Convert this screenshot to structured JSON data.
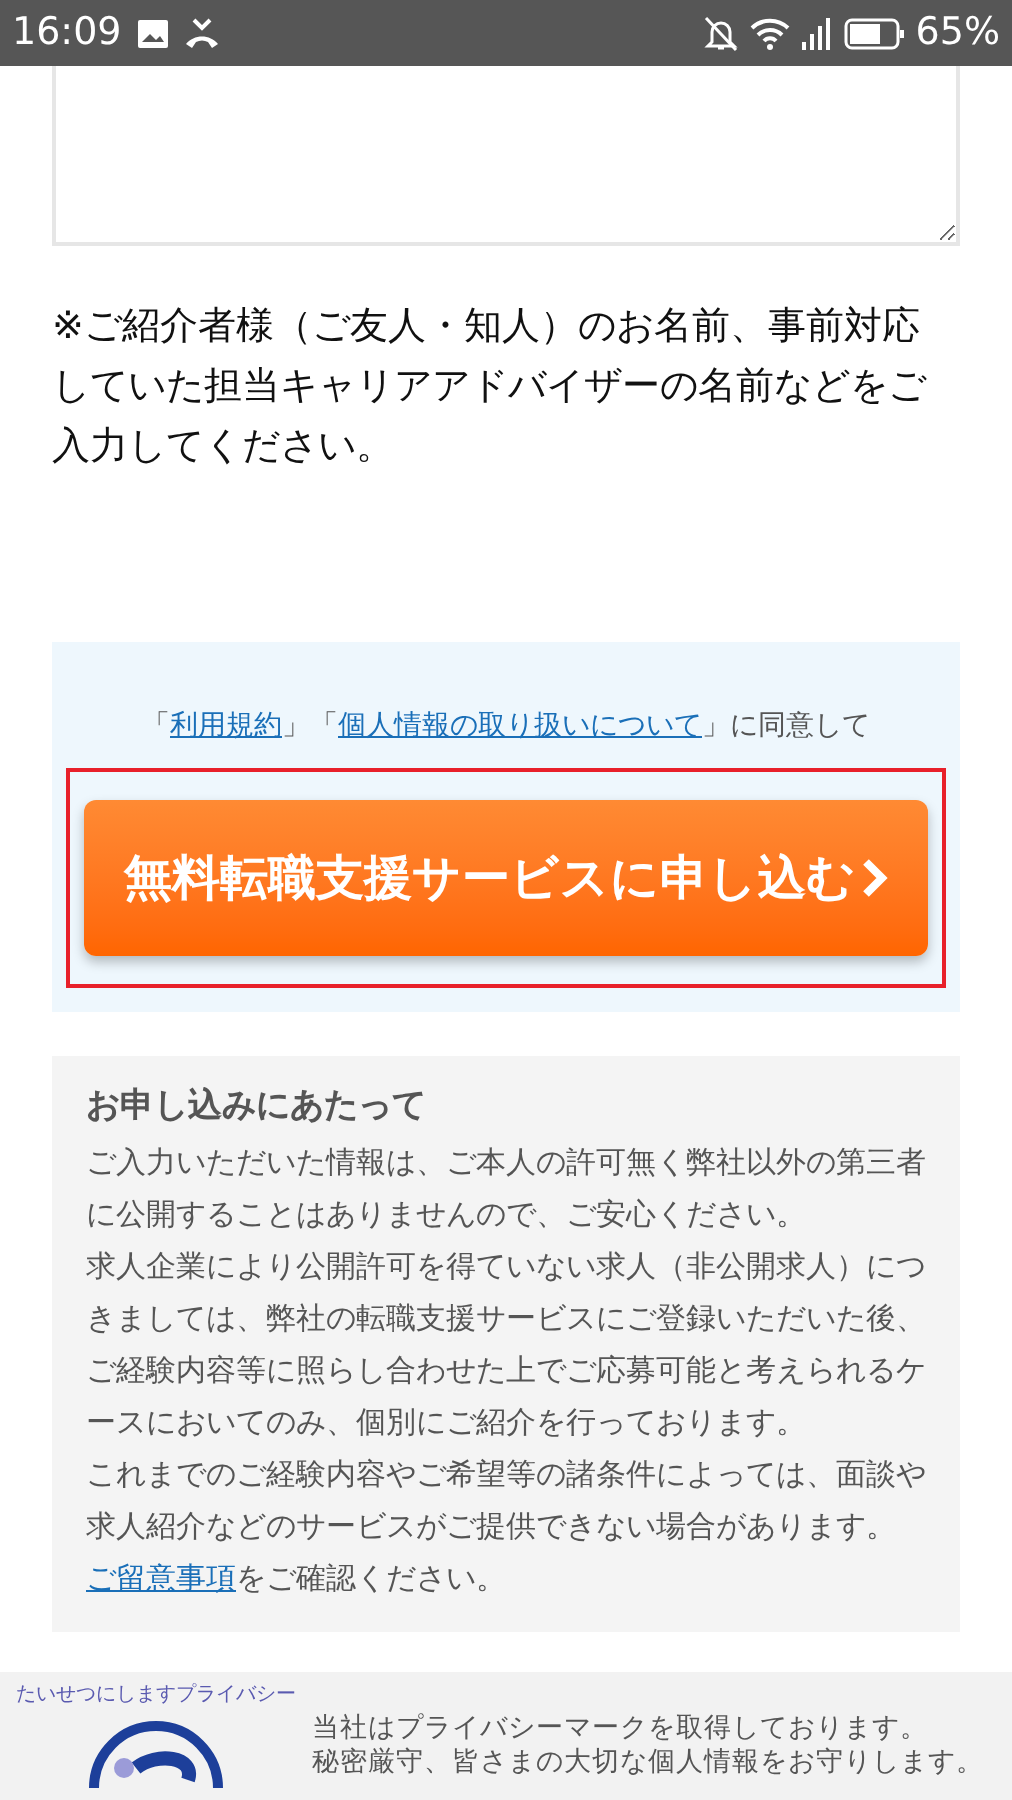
{
  "status_bar": {
    "time": "16:09",
    "battery": "65%"
  },
  "note": "※ご紹介者様（ご友人・知人）のお名前、事前対応していた担当キャリアアドバイザーの名前などをご入力してください。",
  "agreement": {
    "open1": "「",
    "link1": "利用規約",
    "mid": "」「",
    "link2": "個人情報の取り扱いについて",
    "close": "」に同意して"
  },
  "submit_button": {
    "label": "無料転職支援サービスに申し込む"
  },
  "notice": {
    "title": "お申し込みにあたって",
    "paragraphs": [
      "ご入力いただいた情報は、ご本人の許可無く弊社以外の第三者に公開することはありませんので、ご安心ください。",
      "求人企業により公開許可を得ていない求人（非公開求人）につきましては、弊社の転職支援サービスにご登録いただいた後、ご経験内容等に照らし合わせた上でご応募可能と考えられるケースにおいてのみ、個別にご紹介を行っております。"
    ],
    "last": {
      "before": "これまでのご経験内容やご希望等の諸条件によっては、面談や求人紹介などのサービスがご提供できない場合があります。",
      "link": "ご留意事項",
      "after": "をご確認ください。"
    }
  },
  "footer": {
    "logo_text": "たいせつにしますプライバシー",
    "lines": [
      "当社はプライバシーマークを取得しております。",
      "秘密厳守、皆さまの大切な個人情報をお守りします。"
    ]
  }
}
